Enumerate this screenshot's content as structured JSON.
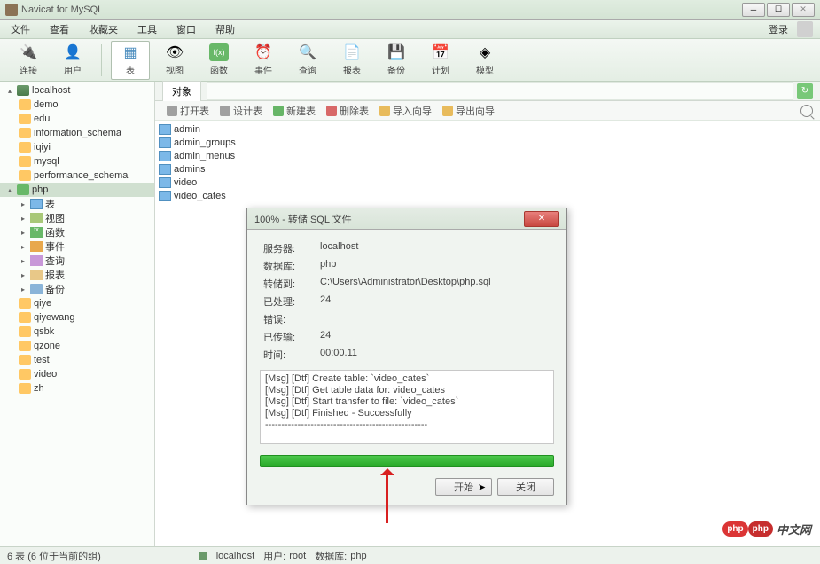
{
  "titlebar": {
    "title": "Navicat for MySQL"
  },
  "menubar": {
    "items": [
      "文件",
      "查看",
      "收藏夹",
      "工具",
      "窗口",
      "帮助"
    ],
    "login": "登录"
  },
  "toolbar": {
    "items": [
      {
        "label": "连接",
        "icon": "🔌"
      },
      {
        "label": "用户",
        "icon": "👤"
      },
      {
        "label": "表",
        "icon": "▦",
        "active": true
      },
      {
        "label": "视图",
        "icon": "👁"
      },
      {
        "label": "函数",
        "icon": "f(x)"
      },
      {
        "label": "事件",
        "icon": "⏰"
      },
      {
        "label": "查询",
        "icon": "🔍"
      },
      {
        "label": "报表",
        "icon": "📄"
      },
      {
        "label": "备份",
        "icon": "💾"
      },
      {
        "label": "计划",
        "icon": "📅"
      },
      {
        "label": "模型",
        "icon": "◈"
      }
    ]
  },
  "sidebar": {
    "connection": "localhost",
    "databases": [
      "demo",
      "edu",
      "information_schema",
      "iqiyi",
      "mysql",
      "performance_schema"
    ],
    "active_db": "php",
    "active_children": [
      {
        "icon": "tbl",
        "label": "表"
      },
      {
        "icon": "view",
        "label": "视图"
      },
      {
        "icon": "fn",
        "label": "函数"
      },
      {
        "icon": "evt",
        "label": "事件"
      },
      {
        "icon": "qry",
        "label": "查询"
      },
      {
        "icon": "rpt",
        "label": "报表"
      },
      {
        "icon": "bak",
        "label": "备份"
      }
    ],
    "databases2": [
      "qiye",
      "qiyewang",
      "qsbk",
      "qzone",
      "test",
      "video",
      "zh"
    ]
  },
  "object_tab": "对象",
  "actions": [
    "打开表",
    "设计表",
    "新建表",
    "删除表",
    "导入向导",
    "导出向导"
  ],
  "tables": [
    "admin",
    "admin_groups",
    "admin_menus",
    "admins",
    "video",
    "video_cates"
  ],
  "dialog": {
    "title": "100% - 转储 SQL 文件",
    "info": {
      "server_lbl": "服务器:",
      "server": "localhost",
      "db_lbl": "数据库:",
      "db": "php",
      "path_lbl": "转储到:",
      "path": "C:\\Users\\Administrator\\Desktop\\php.sql",
      "processed_lbl": "已处理:",
      "processed": "24",
      "error_lbl": "错误:",
      "transferred_lbl": "已传输:",
      "transferred": "24",
      "time_lbl": "时间:",
      "time": "00:00.11"
    },
    "log": [
      "[Msg] [Dtf] Create table: `video_cates`",
      "[Msg] [Dtf] Get table data for: video_cates",
      "[Msg] [Dtf] Start transfer to file: `video_cates`",
      "[Msg] [Dtf] Finished - Successfully",
      "--------------------------------------------------"
    ],
    "start_btn": "开始",
    "close_btn": "关闭"
  },
  "statusbar": {
    "count": "6 表 (6 位于当前的组)",
    "conn": "localhost",
    "user_lbl": "用户:",
    "user": "root",
    "db_lbl": "数据库:",
    "db": "php"
  },
  "watermark": {
    "logo": "php",
    "text": "中文网"
  }
}
